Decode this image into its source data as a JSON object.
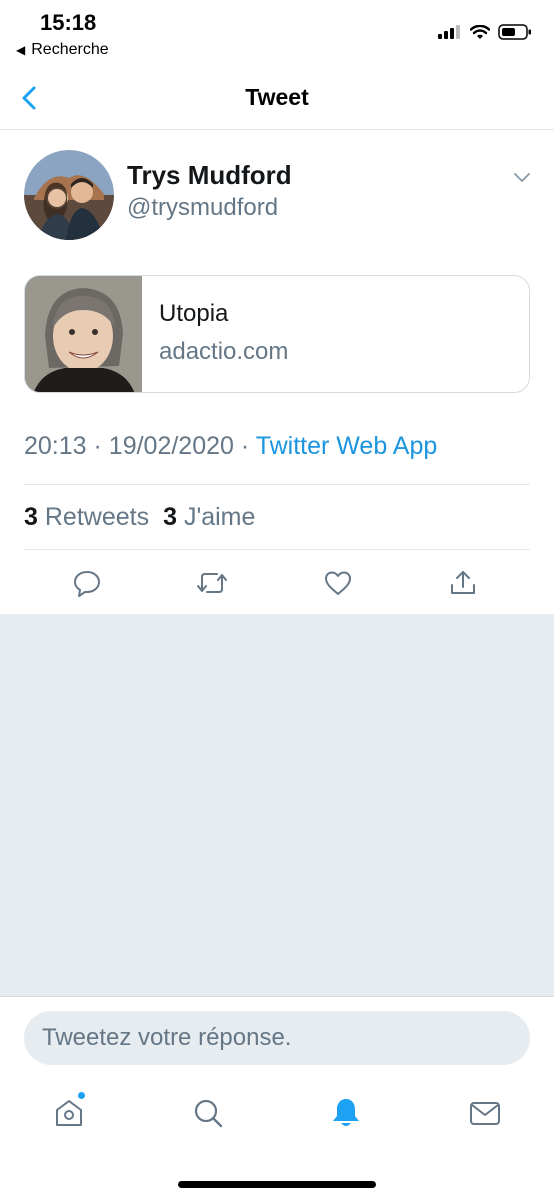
{
  "status_bar": {
    "time": "15:18",
    "back_label": "Recherche"
  },
  "nav": {
    "title": "Tweet"
  },
  "tweet": {
    "author_name": "Trys Mudford",
    "author_handle": "@trysmudford",
    "card": {
      "title": "Utopia",
      "domain": "adactio.com"
    },
    "time": "20:13",
    "date": "19/02/2020",
    "source": "Twitter Web App",
    "retweets_count": "3",
    "retweets_label": "Retweets",
    "likes_count": "3",
    "likes_label": "J'aime"
  },
  "reply": {
    "placeholder": "Tweetez votre réponse."
  },
  "icons": {
    "actions": [
      "reply-icon",
      "retweet-icon",
      "like-icon",
      "share-icon"
    ],
    "tabs": [
      "home-icon",
      "search-icon",
      "notifications-icon",
      "messages-icon"
    ]
  },
  "colors": {
    "accent": "#1da1f2",
    "link": "#1b95e0",
    "secondary_text": "#657786",
    "background": "#e6ecf0"
  }
}
